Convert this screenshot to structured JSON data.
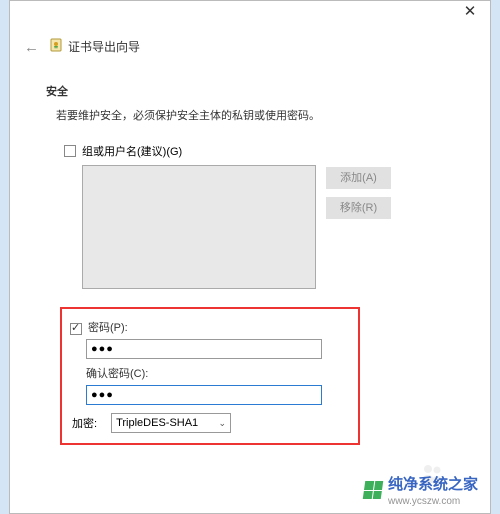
{
  "titlebar": {
    "wizard_title": "证书导出向导"
  },
  "section": {
    "heading": "安全",
    "desc": "若要维护安全，必须保护安全主体的私钥或使用密码。"
  },
  "group": {
    "checkbox_label": "组或用户名(建议)(G)"
  },
  "buttons": {
    "add": "添加(A)",
    "remove": "移除(R)"
  },
  "password": {
    "checkbox_label": "密码(P):",
    "value": "●●●",
    "confirm_label": "确认密码(C):",
    "confirm_value": "●●●",
    "encryption_label": "加密:",
    "encryption_value": "TripleDES-SHA1"
  },
  "watermark": {
    "brand": "纯净系统之家",
    "url": "www.ycszw.com"
  }
}
